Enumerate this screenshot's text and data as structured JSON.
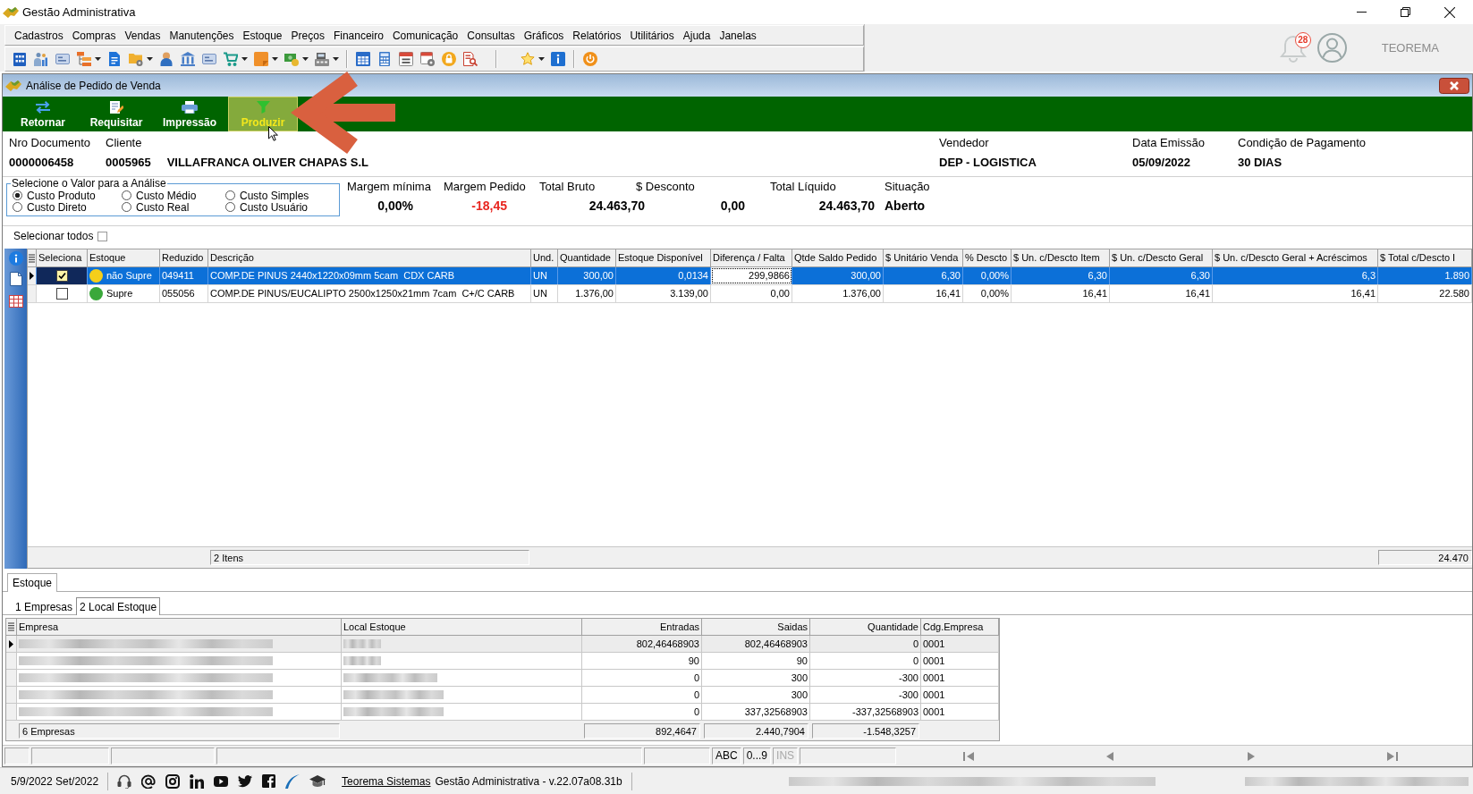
{
  "window": {
    "title": "Gestão Administrativa"
  },
  "menu": [
    "Cadastros",
    "Compras",
    "Vendas",
    "Manutenções",
    "Estoque",
    "Preços",
    "Financeiro",
    "Comunicação",
    "Consultas",
    "Gráficos",
    "Relatórios",
    "Utilitários",
    "Ajuda",
    "Janelas"
  ],
  "notifications": {
    "count": "28"
  },
  "user": {
    "name": "TEOREMA"
  },
  "document_window": {
    "title": "Análise de Pedido de Venda"
  },
  "actions": [
    {
      "label": "Retornar",
      "hovered": false
    },
    {
      "label": "Requisitar",
      "hovered": false
    },
    {
      "label": "Impressão",
      "hovered": false
    },
    {
      "label": "Produzir",
      "hovered": true
    }
  ],
  "header": [
    {
      "label": "Nro Documento",
      "values": [
        "0000006458"
      ]
    },
    {
      "label": "Cliente",
      "values": [
        "0005965",
        "VILLAFRANCA OLIVER CHAPAS S.L"
      ]
    },
    {
      "label": "Vendedor",
      "values": [
        "DEP - LOGISTICA"
      ]
    },
    {
      "label": "Data Emissão",
      "values": [
        "05/09/2022"
      ]
    },
    {
      "label": "Condição de Pagamento",
      "values": [
        "30 DIAS"
      ]
    }
  ],
  "analysis": {
    "title": "Selecione o Valor para a Análise",
    "options": [
      {
        "label": "Custo Produto",
        "selected": true
      },
      {
        "label": "Custo Médio",
        "selected": false
      },
      {
        "label": "Custo Simples",
        "selected": false
      },
      {
        "label": "Custo Direto",
        "selected": false
      },
      {
        "label": "Custo Real",
        "selected": false
      },
      {
        "label": "Custo Usuário",
        "selected": false
      }
    ]
  },
  "totals": [
    {
      "label": "Margem mínima",
      "value": "0,00%",
      "color": "#000000"
    },
    {
      "label": "Margem Pedido",
      "value": "-18,45",
      "color": "#e8251f"
    },
    {
      "label": "Total Bruto",
      "value": "24.463,70",
      "color": "#000000"
    },
    {
      "label": "$ Desconto",
      "value": "0,00",
      "color": "#000000"
    },
    {
      "label": "Total Líquido",
      "value": "24.463,70",
      "color": "#000000"
    },
    {
      "label": "Situação",
      "value": "Aberto",
      "color": "#000000"
    }
  ],
  "select_all": {
    "label": "Selecionar todos",
    "checked": false
  },
  "order_items": {
    "columns": [
      "Seleciona",
      "Estoque",
      "Reduzido",
      "Descrição",
      "Und.",
      "Quantidade",
      "Estoque Disponível",
      "Diferença / Falta",
      "Qtde Saldo Pedido",
      "$ Unitário Venda",
      "% Descto",
      "$ Un. c/Descto Item",
      "$ Un. c/Descto Geral",
      "$ Un. c/Descto Geral + Acréscimos",
      "$ Total c/Descto I"
    ],
    "rows": [
      {
        "current": true,
        "selected": true,
        "cells": [
          {
            "kind": "checkbox",
            "checked": true
          },
          {
            "kind": "status",
            "text": "não Supre",
            "color": "#f5cf1a"
          },
          {
            "kind": "text",
            "text": "049411",
            "focused": false
          },
          {
            "kind": "text",
            "text": "COMP.DE PINUS 2440x1220x09mm 5cam  CDX CARB",
            "focused": false
          },
          {
            "kind": "text",
            "text": "UN",
            "focused": false
          },
          {
            "kind": "text",
            "text": "300,00",
            "focused": false
          },
          {
            "kind": "text",
            "text": "0,0134",
            "focused": false
          },
          {
            "kind": "text",
            "text": "299,9866",
            "focused": true
          },
          {
            "kind": "text",
            "text": "300,00",
            "focused": false
          },
          {
            "kind": "text",
            "text": "6,30",
            "focused": false
          },
          {
            "kind": "text",
            "text": "0,00%",
            "focused": false
          },
          {
            "kind": "text",
            "text": "6,30",
            "focused": false
          },
          {
            "kind": "text",
            "text": "6,30",
            "focused": false
          },
          {
            "kind": "text",
            "text": "6,3",
            "focused": false
          },
          {
            "kind": "text",
            "text": "1.890",
            "focused": false
          }
        ]
      },
      {
        "current": false,
        "selected": false,
        "cells": [
          {
            "kind": "checkbox",
            "checked": false
          },
          {
            "kind": "status",
            "text": "Supre",
            "color": "#3aa83a"
          },
          {
            "kind": "text",
            "text": "055056",
            "focused": false
          },
          {
            "kind": "text",
            "text": "COMP.DE PINUS/EUCALIPTO 2500x1250x21mm 7cam  C+/C CARB",
            "focused": false
          },
          {
            "kind": "text",
            "text": "UN",
            "focused": false
          },
          {
            "kind": "text",
            "text": "1.376,00",
            "focused": false
          },
          {
            "kind": "text",
            "text": "3.139,00",
            "focused": false
          },
          {
            "kind": "text",
            "text": "0,00",
            "focused": false
          },
          {
            "kind": "text",
            "text": "1.376,00",
            "focused": false
          },
          {
            "kind": "text",
            "text": "16,41",
            "focused": false
          },
          {
            "kind": "text",
            "text": "0,00%",
            "focused": false
          },
          {
            "kind": "text",
            "text": "16,41",
            "focused": false
          },
          {
            "kind": "text",
            "text": "16,41",
            "focused": false
          },
          {
            "kind": "text",
            "text": "16,41",
            "focused": false
          },
          {
            "kind": "text",
            "text": "22.580",
            "focused": false
          }
        ]
      }
    ],
    "footer": {
      "count": "2 Itens",
      "total": "24.470"
    }
  },
  "stock_panel": {
    "tabs": [
      {
        "label": "Estoque",
        "selected": true
      }
    ],
    "sub_tabs": [
      {
        "label": "1 Empresas",
        "selected": false
      },
      {
        "label": "2 Local Estoque",
        "selected": true
      }
    ],
    "columns": [
      "Empresa",
      "Local Estoque",
      "Entradas",
      "Saidas",
      "Quantidade",
      "Cdg.Empresa"
    ],
    "rows": [
      {
        "current": true,
        "cells": [
          null,
          null,
          "802,46468903",
          "802,46468903",
          "0",
          "0001"
        ]
      },
      {
        "current": false,
        "cells": [
          null,
          null,
          "90",
          "90",
          "0",
          "0001"
        ]
      },
      {
        "current": false,
        "cells": [
          null,
          null,
          "0",
          "300",
          "-300",
          "0001"
        ]
      },
      {
        "current": false,
        "cells": [
          null,
          null,
          "0",
          "300",
          "-300",
          "0001"
        ]
      },
      {
        "current": false,
        "cells": [
          null,
          null,
          "0",
          "337,32568903",
          "-337,32568903",
          "0001"
        ]
      }
    ],
    "footer": {
      "count": "6 Empresas",
      "totals": [
        "892,4647",
        "2.440,7904",
        "-1.548,3257"
      ]
    }
  },
  "status_indicators": [
    {
      "label": "ABC",
      "enabled": true
    },
    {
      "label": "0...9",
      "enabled": true
    },
    {
      "label": "INS",
      "enabled": false
    }
  ],
  "status_bar": {
    "date": "5/9/2022 Set/2022",
    "link": "Teorema Sistemas",
    "version": "Gestão Administrativa - v.22.07a08.31b"
  }
}
